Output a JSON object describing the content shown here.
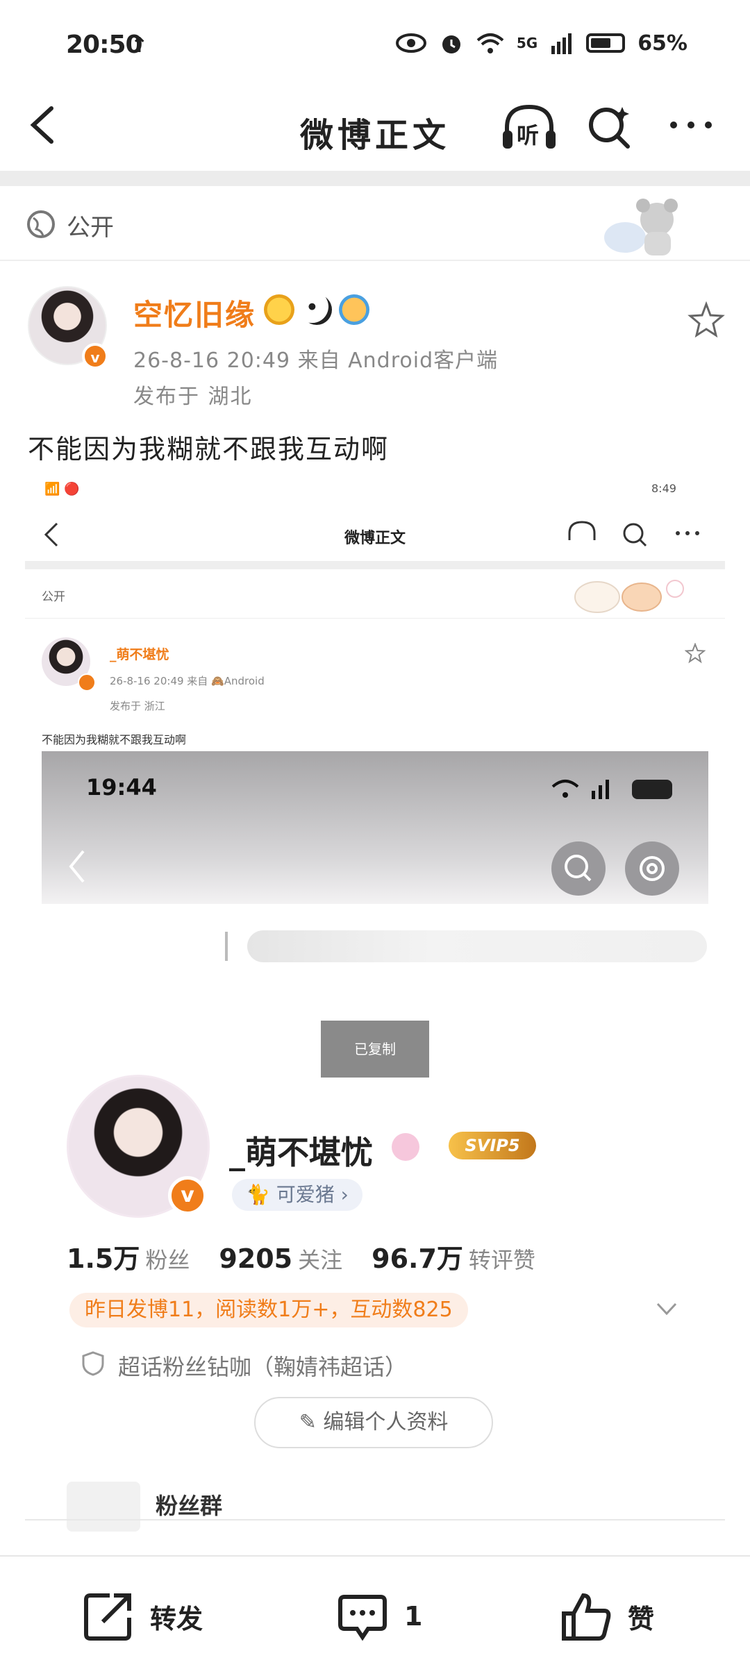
{
  "status_bar": {
    "time": "20:50",
    "upload_arrow": "↑",
    "network": "5G",
    "battery": "65%"
  },
  "nav": {
    "title": "微博正文",
    "listen_label": "听"
  },
  "post": {
    "visibility": "公开",
    "author": "空忆旧缘",
    "verified_badge": "v",
    "meta": "26-8-16 20:49  来自 Android客户端",
    "location": "发布于 湖北",
    "text": "不能因为我糊就不跟我互动啊"
  },
  "embedded": {
    "status_time": "8:49",
    "title": "微博正文",
    "visibility": "公开",
    "author": "_萌不堪忧",
    "meta": "26-8-16 20:49  来自 🙈Android",
    "location": "发布于 浙江",
    "text": "不能因为我糊就不跟我互动啊",
    "inner": {
      "time": "19:44",
      "toast": "已复制",
      "profile_name": "_萌不堪忧",
      "svip": "SVIP5",
      "tag": "🐈 可爱猪 ›",
      "stats": [
        {
          "num": "1.5万",
          "label": "粉丝"
        },
        {
          "num": "9205",
          "label": "关注"
        },
        {
          "num": "96.7万",
          "label": "转评赞"
        }
      ],
      "notice": "昨日发博11，阅读数1万+，互动数825",
      "chaohua": "超话粉丝钻咖（鞠婧祎超话）",
      "edit_button": "✎ 编辑个人资料",
      "fans_group": "粉丝群"
    }
  },
  "bottom": {
    "repost": "转发",
    "comment_count": "1",
    "like": "赞"
  },
  "icons": [
    "back-arrow-icon",
    "listen-icon",
    "search-icon",
    "more-icon",
    "globe-icon",
    "star-icon",
    "repost-icon",
    "comment-icon",
    "like-icon"
  ],
  "colors": {
    "accent": "#f07d1a",
    "text": "#222222",
    "muted": "#888888"
  }
}
